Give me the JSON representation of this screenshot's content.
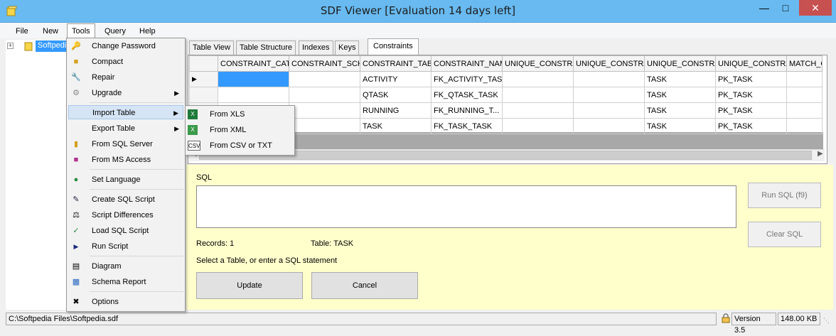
{
  "window": {
    "title": "SDF Viewer [Evaluation 14 days left]",
    "minimize": "—",
    "maximize": "□",
    "close": "✕"
  },
  "menubar": {
    "items": [
      "File",
      "New",
      "Tools",
      "Query",
      "Help"
    ]
  },
  "tree": {
    "expander": "+",
    "root_label": "Softpedia"
  },
  "tabs": [
    "Table View",
    "Table Structure",
    "Indexes",
    "Keys",
    "Constraints"
  ],
  "grid": {
    "columns": [
      "CONSTRAINT_CATA",
      "CONSTRAINT_SCH",
      "CONSTRAINT_TABL",
      "CONSTRAINT_NAM",
      "UNIQUE_CONSTRA",
      "UNIQUE_CONSTRA",
      "UNIQUE_CONSTRA",
      "UNIQUE_CONSTRA",
      "MATCH_O"
    ],
    "current_row_marker": "▶",
    "rows": [
      [
        "",
        "",
        "ACTIVITY",
        "FK_ACTIVITY_TASK",
        "",
        "",
        "TASK",
        "PK_TASK",
        ""
      ],
      [
        "",
        "",
        "QTASK",
        "FK_QTASK_TASK",
        "",
        "",
        "TASK",
        "PK_TASK",
        ""
      ],
      [
        "",
        "",
        "RUNNING",
        "FK_RUNNING_T...",
        "",
        "",
        "TASK",
        "PK_TASK",
        ""
      ],
      [
        "",
        "",
        "TASK",
        "FK_TASK_TASK",
        "",
        "",
        "TASK",
        "PK_TASK",
        ""
      ]
    ]
  },
  "sql": {
    "label": "SQL",
    "value": "",
    "run_button": "Run SQL (f9)",
    "clear_button": "Clear SQL",
    "records": "Records: 1",
    "table": "Table: TASK",
    "status": "Select a Table, or enter a SQL statement",
    "update_button": "Update",
    "cancel_button": "Cancel"
  },
  "tools_menu": [
    {
      "label": "Change Password",
      "icon": "key-icon"
    },
    {
      "label": "Compact",
      "icon": "compact-icon"
    },
    {
      "label": "Repair",
      "icon": "wrench-icon"
    },
    {
      "label": "Upgrade",
      "icon": "upgrade-icon",
      "submenu": true
    },
    {
      "label": "Import Table",
      "icon": "",
      "submenu": true
    },
    {
      "label": "Export Table",
      "icon": "",
      "submenu": true
    },
    {
      "label": "From SQL Server",
      "icon": "database-icon"
    },
    {
      "label": "From MS Access",
      "icon": "access-icon"
    },
    {
      "label": "Set Language",
      "icon": "globe-icon"
    },
    {
      "label": "Create SQL Script",
      "icon": "pen-icon"
    },
    {
      "label": "Script Differences",
      "icon": "scales-icon"
    },
    {
      "label": "Load SQL Script",
      "icon": "check-icon"
    },
    {
      "label": "Run Script",
      "icon": "play-icon"
    },
    {
      "label": "Diagram",
      "icon": "diagram-icon"
    },
    {
      "label": "Schema Report",
      "icon": "report-icon"
    },
    {
      "label": "Options",
      "icon": "tools-icon"
    }
  ],
  "import_submenu": [
    {
      "label": "From XLS",
      "icon": "excel-icon"
    },
    {
      "label": "From XML",
      "icon": "xml-icon"
    },
    {
      "label": "From CSV or TXT",
      "icon": "csv-icon",
      "icon_text": "CSV"
    }
  ],
  "statusbar": {
    "path": "C:\\Softpedia Files\\Softpedia.sdf",
    "version": "Version 3.5",
    "size": "148.00 KB"
  },
  "colors": {
    "titlebar": "#68baf0",
    "selection": "#3399ff",
    "sql_pane": "#ffffcc",
    "close_button": "#c75050"
  }
}
